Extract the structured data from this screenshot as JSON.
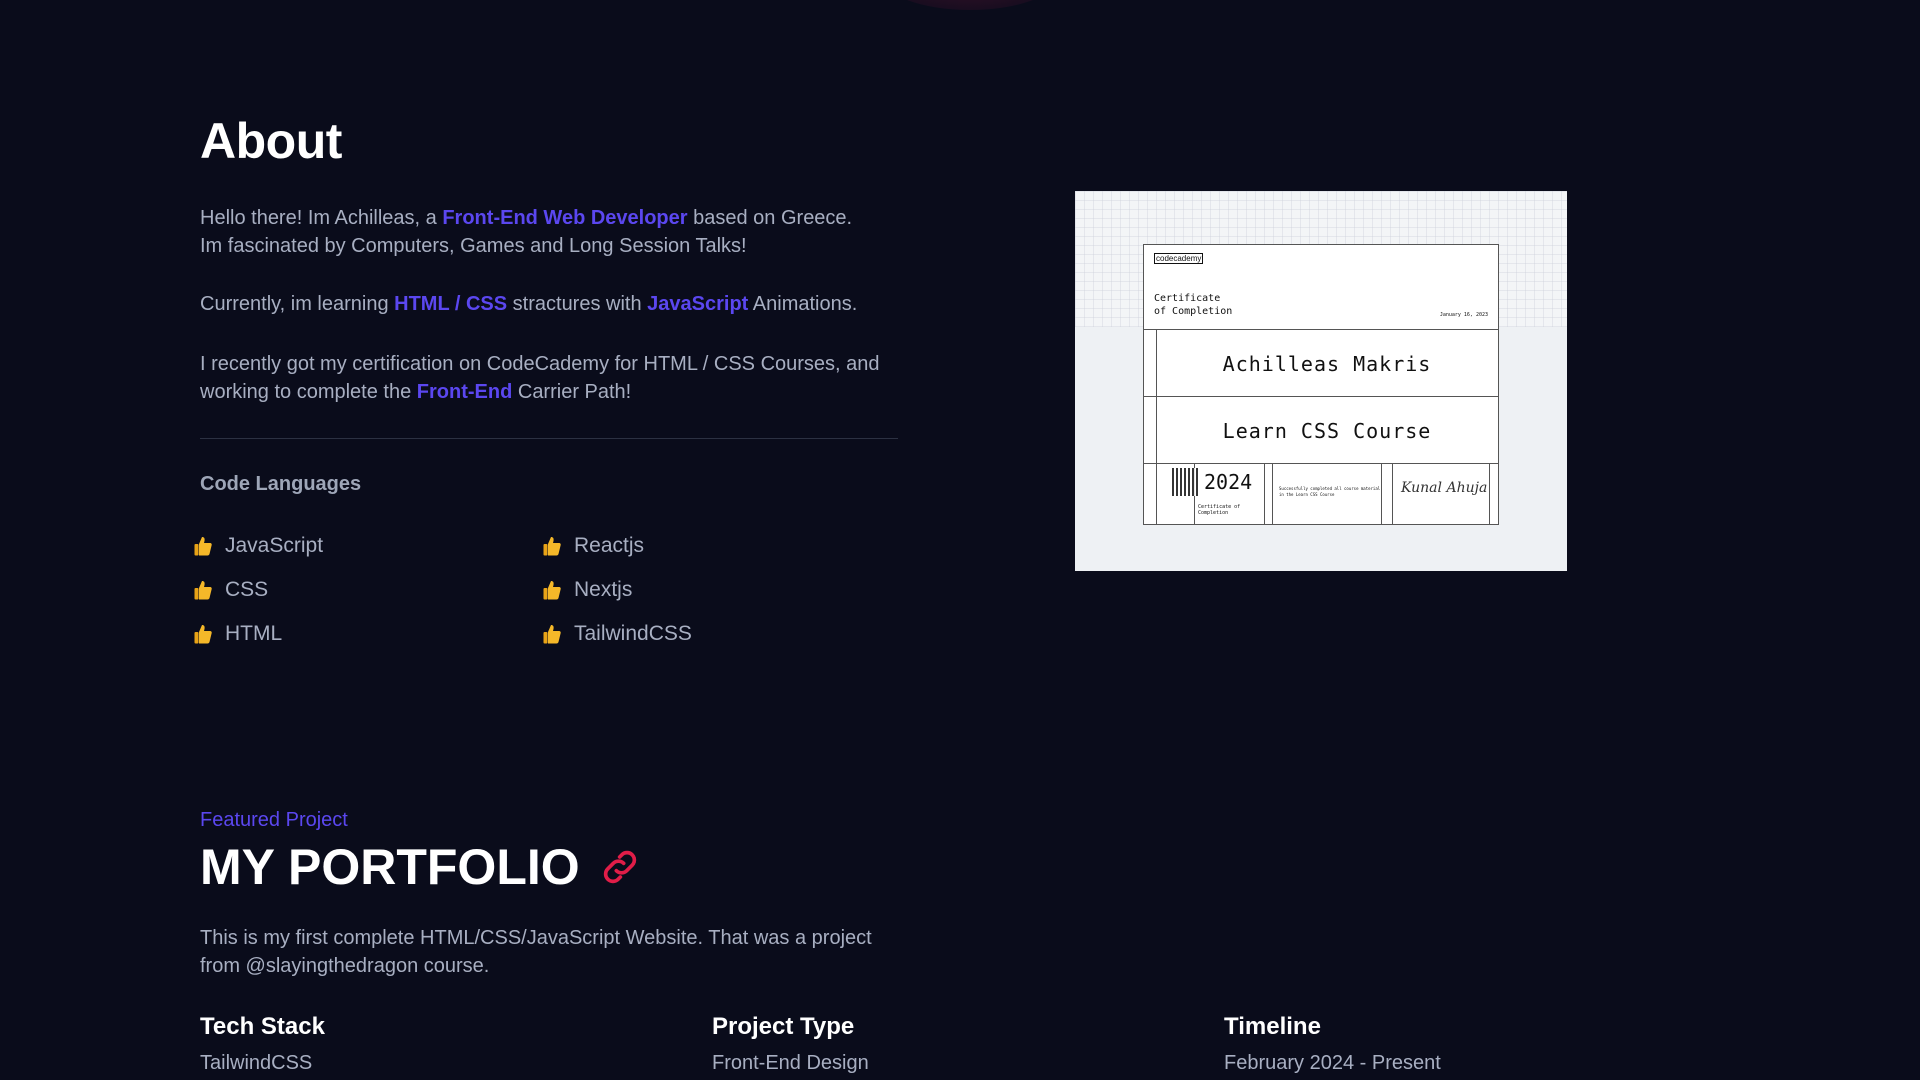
{
  "about": {
    "title": "About",
    "p1": {
      "a": "Hello there! Im Achilleas, a ",
      "b": "Front-End Web Developer",
      "c": " based on Greece.",
      "d": "Im fascinated by Computers, Games and Long Session Talks!"
    },
    "p2": {
      "a": "Currently, im learning ",
      "b": "HTML / CSS",
      "c": " stractures with ",
      "d": "JavaScript",
      "e": " Animations."
    },
    "p3": {
      "a": "I recently got my certification on CodeCademy for HTML / CSS Courses, and working to complete the ",
      "b": "Front-End",
      "c": " Carrier Path!"
    },
    "languages_title": "Code Languages",
    "languages_left": [
      "JavaScript",
      "CSS",
      "HTML"
    ],
    "languages_right": [
      "Reactjs",
      "Nextjs",
      "TailwindCSS"
    ]
  },
  "certificate": {
    "logo": "codecademy",
    "heading_line1": "Certificate",
    "heading_line2": "of Completion",
    "date": "January 16, 2023",
    "name": "Achilleas Makris",
    "course": "Learn CSS Course",
    "year": "2024",
    "year_sub": "Certificate of Completion",
    "description": "Successfully completed all course material in the Learn CSS Course",
    "signature": "Kunal Ahuja"
  },
  "project": {
    "label": "Featured Project",
    "title": "MY PORTFOLIO",
    "description": "This is my first complete HTML/CSS/JavaScript Website. That was a project from @slayingthedragon course.",
    "tech_title": "Tech Stack",
    "tech_value": "TailwindCSS",
    "type_title": "Project Type",
    "type_value": "Front-End Design",
    "timeline_title": "Timeline",
    "timeline_value": "February 2024 - Present"
  },
  "colors": {
    "background": "#0a0c1b",
    "accent": "#5b47f0",
    "link_icon": "#e11d48"
  },
  "icons": {
    "language_bullet": "thumbs-up-icon",
    "project_link": "link-icon"
  }
}
